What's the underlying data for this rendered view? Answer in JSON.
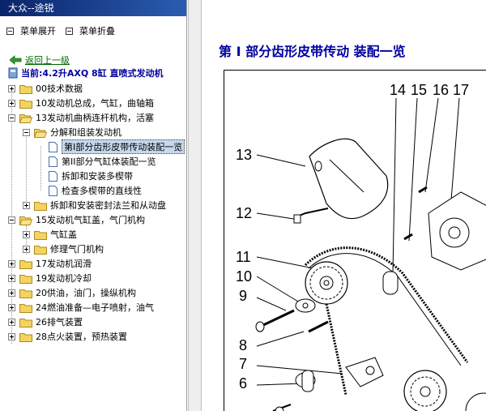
{
  "window": {
    "title": "大众--途锐"
  },
  "toolbar": {
    "expand_label": "菜单展开",
    "collapse_label": "菜单折叠"
  },
  "nav": {
    "back_label": "返回上一级",
    "current_label": "当前:4.2升AXQ 8缸 直喷式发动机"
  },
  "tree": {
    "items": [
      {
        "label": "00技术数据"
      },
      {
        "label": "10发动机总成，气缸，曲轴箱"
      },
      {
        "label": "13发动机曲柄连杆机构，活塞"
      },
      {
        "label": "分解和组装发动机"
      },
      {
        "label": "第I部分齿形皮带传动装配一览"
      },
      {
        "label": "第II部分气缸体装配一览"
      },
      {
        "label": "拆卸和安装多楔带"
      },
      {
        "label": "检查多楔带的直线性"
      },
      {
        "label": "拆卸和安装密封法兰和从动盘"
      },
      {
        "label": "15发动机气缸盖，气门机构"
      },
      {
        "label": "气缸盖"
      },
      {
        "label": "修理气门机构"
      },
      {
        "label": "17发动机润滑"
      },
      {
        "label": "19发动机冷却"
      },
      {
        "label": "20供油，油门，操纵机构"
      },
      {
        "label": "24燃油准备—电子喷射，油气"
      },
      {
        "label": "26排气装置"
      },
      {
        "label": "28点火装置，预热装置"
      }
    ]
  },
  "content": {
    "title": "第 I 部分齿形皮带传动 装配一览",
    "callouts": [
      "14",
      "15",
      "16",
      "17",
      "13",
      "12",
      "11",
      "10",
      "9",
      "8",
      "7",
      "6"
    ]
  }
}
